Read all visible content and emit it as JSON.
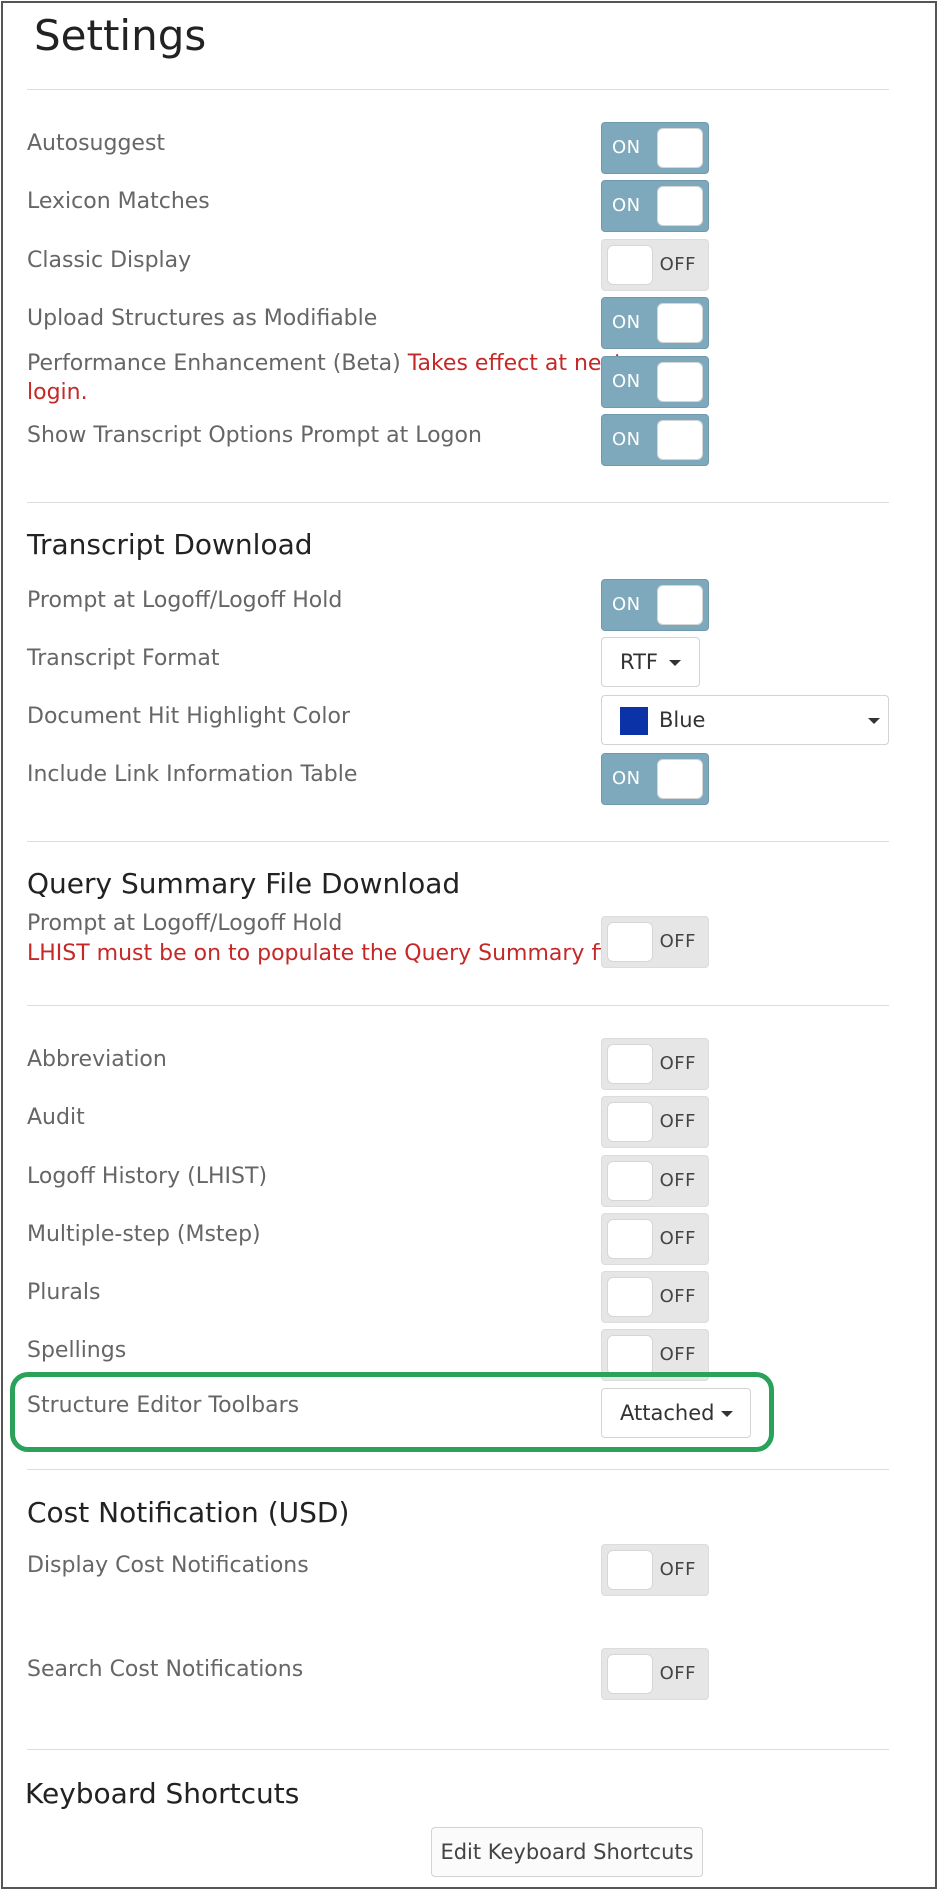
{
  "title": "Settings",
  "general": {
    "autosuggest": {
      "label": "Autosuggest",
      "state": "ON"
    },
    "lexicon": {
      "label": "Lexicon Matches",
      "state": "ON"
    },
    "classic": {
      "label": "Classic Display",
      "state": "OFF"
    },
    "upload": {
      "label": "Upload Structures as Modifiable",
      "state": "ON"
    },
    "performance": {
      "label": "Performance Enhancement (Beta)",
      "note_line1": "Takes effect at next",
      "note_line2": "login.",
      "state": "ON"
    },
    "transcript_prompt": {
      "label": "Show Transcript Options Prompt at Logon",
      "state": "ON"
    }
  },
  "transcript": {
    "title": "Transcript Download",
    "prompt": {
      "label": "Prompt at Logoff/Logoff Hold",
      "state": "ON"
    },
    "format": {
      "label": "Transcript Format",
      "value": "RTF"
    },
    "highlight": {
      "label": "Document Hit Highlight Color",
      "value": "Blue",
      "color": "#0b32a6"
    },
    "link_table": {
      "label": "Include Link Information Table",
      "state": "ON"
    }
  },
  "query_summary": {
    "title": "Query Summary File Download",
    "prompt_label": "Prompt at Logoff/Logoff Hold",
    "warning": "LHIST must be on to populate the Query Summary file.",
    "state": "OFF"
  },
  "options": {
    "abbreviation": {
      "label": "Abbreviation",
      "state": "OFF"
    },
    "audit": {
      "label": "Audit",
      "state": "OFF"
    },
    "lhist": {
      "label": "Logoff History (LHIST)",
      "state": "OFF"
    },
    "mstep": {
      "label": "Multiple-step (Mstep)",
      "state": "OFF"
    },
    "plurals": {
      "label": "Plurals",
      "state": "OFF"
    },
    "spellings": {
      "label": "Spellings",
      "state": "OFF"
    },
    "toolbars": {
      "label": "Structure Editor Toolbars",
      "value": "Attached"
    }
  },
  "cost": {
    "title": "Cost Notification (USD)",
    "display": {
      "label": "Display Cost Notifications",
      "state": "OFF"
    },
    "search": {
      "label": "Search Cost Notifications",
      "state": "OFF"
    }
  },
  "keyboard": {
    "title": "Keyboard Shortcuts",
    "button": "Edit Keyboard Shortcuts"
  }
}
